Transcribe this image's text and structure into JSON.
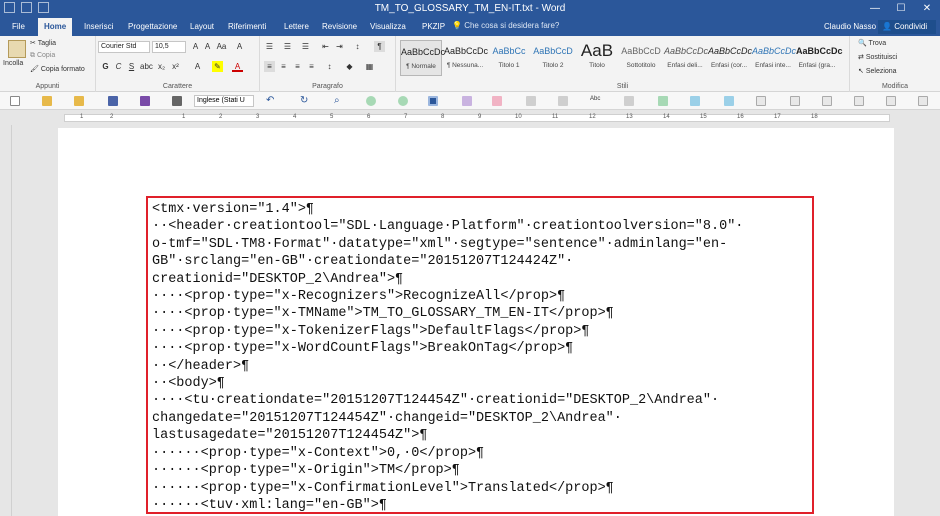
{
  "window": {
    "title": "TM_TO_GLOSSARY_TM_EN-IT.txt - Word",
    "user": "Claudio Nasso",
    "share_label": "Condividi",
    "tell_me": "Che cosa si desidera fare?"
  },
  "tabs": [
    "File",
    "Home",
    "Inserisci",
    "Progettazione",
    "Layout",
    "Riferimenti",
    "Lettere",
    "Revisione",
    "Visualizza",
    "PKZIP"
  ],
  "ribbon": {
    "clipboard": {
      "label": "Appunti",
      "paste": "Incolla",
      "cut": "Taglia",
      "copy": "Copia",
      "format_painter": "Copia formato"
    },
    "font": {
      "label": "Carattere",
      "family": "Courier Std",
      "size": "10,5",
      "bold": "G",
      "italic": "C",
      "underline": "S"
    },
    "paragraph": {
      "label": "Paragrafo"
    },
    "styles": {
      "label": "Stili",
      "items": [
        {
          "preview": "AaBbCcDc",
          "name": "¶ Normale"
        },
        {
          "preview": "AaBbCcDc",
          "name": "¶ Nessuna..."
        },
        {
          "preview": "AaBbCc",
          "name": "Titolo 1"
        },
        {
          "preview": "AaBbCcD",
          "name": "Titolo 2"
        },
        {
          "preview": "AaB",
          "name": "Titolo"
        },
        {
          "preview": "AaBbCcD",
          "name": "Sottotitolo"
        },
        {
          "preview": "AaBbCcDc",
          "name": "Enfasi deli..."
        },
        {
          "preview": "AaBbCcDc",
          "name": "Enfasi (cor..."
        },
        {
          "preview": "AaBbCcDc",
          "name": "Enfasi inte..."
        },
        {
          "preview": "AaBbCcDc",
          "name": "Enfasi (gra..."
        }
      ]
    },
    "editing": {
      "label": "Modifica",
      "find": "Trova",
      "replace": "Sostituisci",
      "select": "Seleziona"
    }
  },
  "toolbar": {
    "language": "Inglese (Stati U"
  },
  "ruler": {
    "numbers": [
      "1",
      "2",
      "1",
      "2",
      "3",
      "4",
      "5",
      "6",
      "7",
      "8",
      "9",
      "10",
      "11",
      "12",
      "13",
      "14",
      "15",
      "16",
      "17",
      "18"
    ]
  },
  "document": {
    "lines": [
      "<tmx·version=\"1.4\">¶",
      "··<header·creationtool=\"SDL·Language·Platform\"·creationtoolversion=\"8.0\"·",
      "o-tmf=\"SDL·TM8·Format\"·datatype=\"xml\"·segtype=\"sentence\"·adminlang=\"en-",
      "GB\"·srclang=\"en-GB\"·creationdate=\"20151207T124424Z\"·",
      "creationid=\"DESKTOP_2\\Andrea\">¶",
      "····<prop·type=\"x-Recognizers\">RecognizeAll</prop>¶",
      "····<prop·type=\"x-TMName\">TM_TO_GLOSSARY_TM_EN-IT</prop>¶",
      "····<prop·type=\"x-TokenizerFlags\">DefaultFlags</prop>¶",
      "····<prop·type=\"x-WordCountFlags\">BreakOnTag</prop>¶",
      "··</header>¶",
      "··<body>¶",
      "····<tu·creationdate=\"20151207T124454Z\"·creationid=\"DESKTOP_2\\Andrea\"·",
      "changedate=\"20151207T124454Z\"·changeid=\"DESKTOP_2\\Andrea\"·",
      "lastusagedate=\"20151207T124454Z\">¶",
      "······<prop·type=\"x-Context\">0,·0</prop>¶",
      "······<prop·type=\"x-Origin\">TM</prop>¶",
      "······<prop·type=\"x-ConfirmationLevel\">Translated</prop>¶",
      "······<tuv·xml:lang=\"en-GB\">¶"
    ]
  },
  "colors": {
    "brand": "#2b579a",
    "highlight_box": "#e0202a"
  }
}
